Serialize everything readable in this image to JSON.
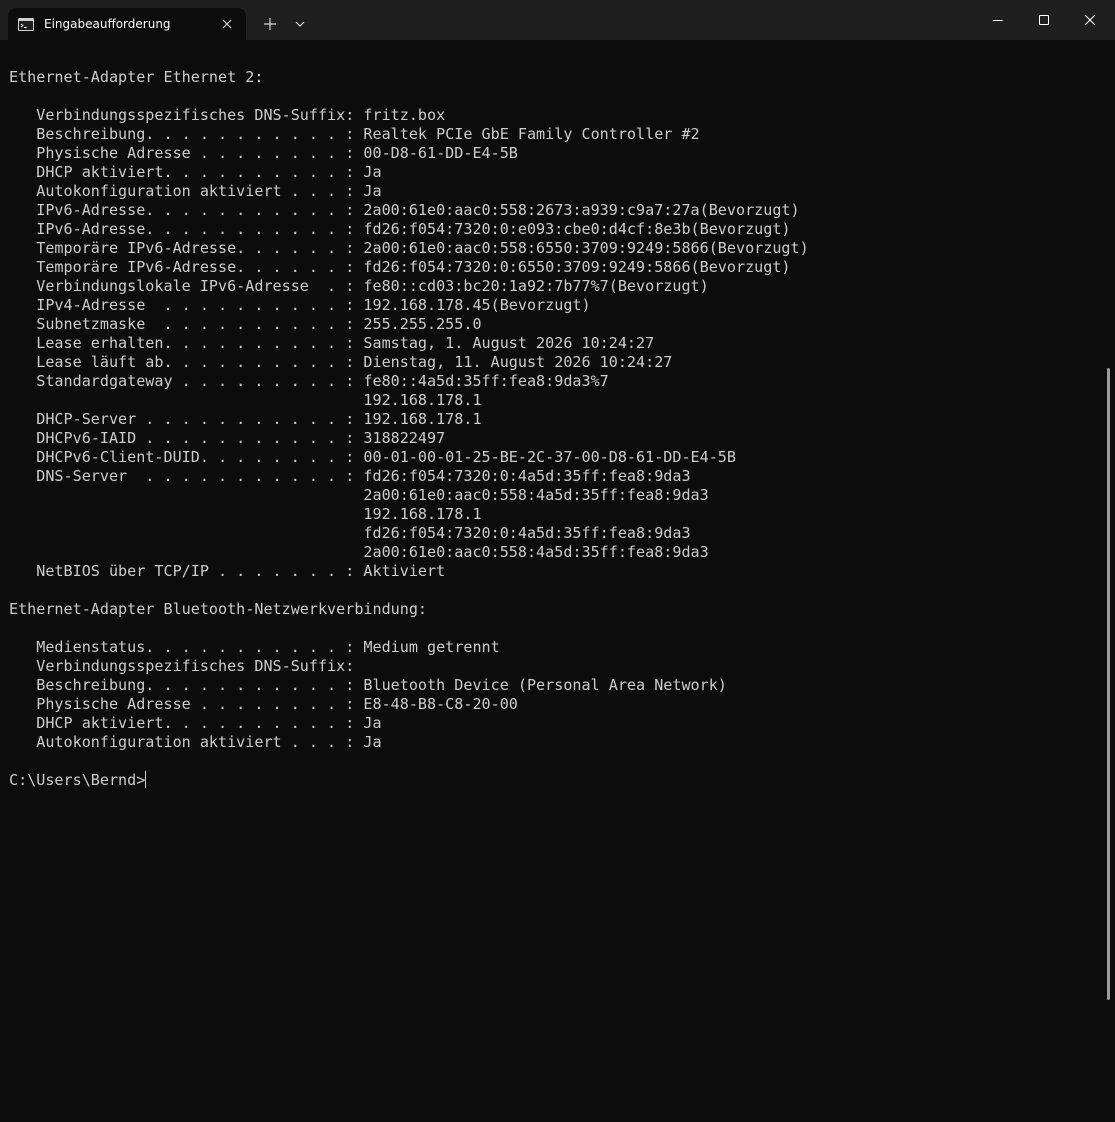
{
  "window": {
    "tab_title": "Eingabeaufforderung",
    "icons": {
      "tab": "terminal-icon",
      "close_tab": "close-icon",
      "new_tab": "plus-icon",
      "dropdown": "chevron-down-icon",
      "minimize": "minimize-icon",
      "maximize": "maximize-icon",
      "close_window": "close-icon"
    }
  },
  "colors": {
    "background": "#0c0c0c",
    "titlebar": "#1f1f1f",
    "text": "#cccccc"
  },
  "terminal": {
    "lines": [
      "Ethernet-Adapter Ethernet 2:",
      "",
      "   Verbindungsspezifisches DNS-Suffix: fritz.box",
      "   Beschreibung. . . . . . . . . . . : Realtek PCIe GbE Family Controller #2",
      "   Physische Adresse . . . . . . . . : 00-D8-61-DD-E4-5B",
      "   DHCP aktiviert. . . . . . . . . . : Ja",
      "   Autokonfiguration aktiviert . . . : Ja",
      "   IPv6-Adresse. . . . . . . . . . . : 2a00:61e0:aac0:558:2673:a939:c9a7:27a(Bevorzugt)",
      "   IPv6-Adresse. . . . . . . . . . . : fd26:f054:7320:0:e093:cbe0:d4cf:8e3b(Bevorzugt)",
      "   Temporäre IPv6-Adresse. . . . . . : 2a00:61e0:aac0:558:6550:3709:9249:5866(Bevorzugt)",
      "   Temporäre IPv6-Adresse. . . . . . : fd26:f054:7320:0:6550:3709:9249:5866(Bevorzugt)",
      "   Verbindungslokale IPv6-Adresse  . : fe80::cd03:bc20:1a92:7b77%7(Bevorzugt)",
      "   IPv4-Adresse  . . . . . . . . . . : 192.168.178.45(Bevorzugt)",
      "   Subnetzmaske  . . . . . . . . . . : 255.255.255.0",
      "   Lease erhalten. . . . . . . . . . : Samstag, 1. August 2026 10:24:27",
      "   Lease läuft ab. . . . . . . . . . : Dienstag, 11. August 2026 10:24:27",
      "   Standardgateway . . . . . . . . . : fe80::4a5d:35ff:fea8:9da3%7",
      "                                       192.168.178.1",
      "   DHCP-Server . . . . . . . . . . . : 192.168.178.1",
      "   DHCPv6-IAID . . . . . . . . . . . : 318822497",
      "   DHCPv6-Client-DUID. . . . . . . . : 00-01-00-01-25-BE-2C-37-00-D8-61-DD-E4-5B",
      "   DNS-Server  . . . . . . . . . . . : fd26:f054:7320:0:4a5d:35ff:fea8:9da3",
      "                                       2a00:61e0:aac0:558:4a5d:35ff:fea8:9da3",
      "                                       192.168.178.1",
      "                                       fd26:f054:7320:0:4a5d:35ff:fea8:9da3",
      "                                       2a00:61e0:aac0:558:4a5d:35ff:fea8:9da3",
      "   NetBIOS über TCP/IP . . . . . . . : Aktiviert",
      "",
      "Ethernet-Adapter Bluetooth-Netzwerkverbindung:",
      "",
      "   Medienstatus. . . . . . . . . . . : Medium getrennt",
      "   Verbindungsspezifisches DNS-Suffix:",
      "   Beschreibung. . . . . . . . . . . : Bluetooth Device (Personal Area Network)",
      "   Physische Adresse . . . . . . . . : E8-48-B8-C8-20-00",
      "   DHCP aktiviert. . . . . . . . . . : Ja",
      "   Autokonfiguration aktiviert . . . : Ja",
      ""
    ],
    "prompt": "C:\\Users\\Bernd>"
  }
}
